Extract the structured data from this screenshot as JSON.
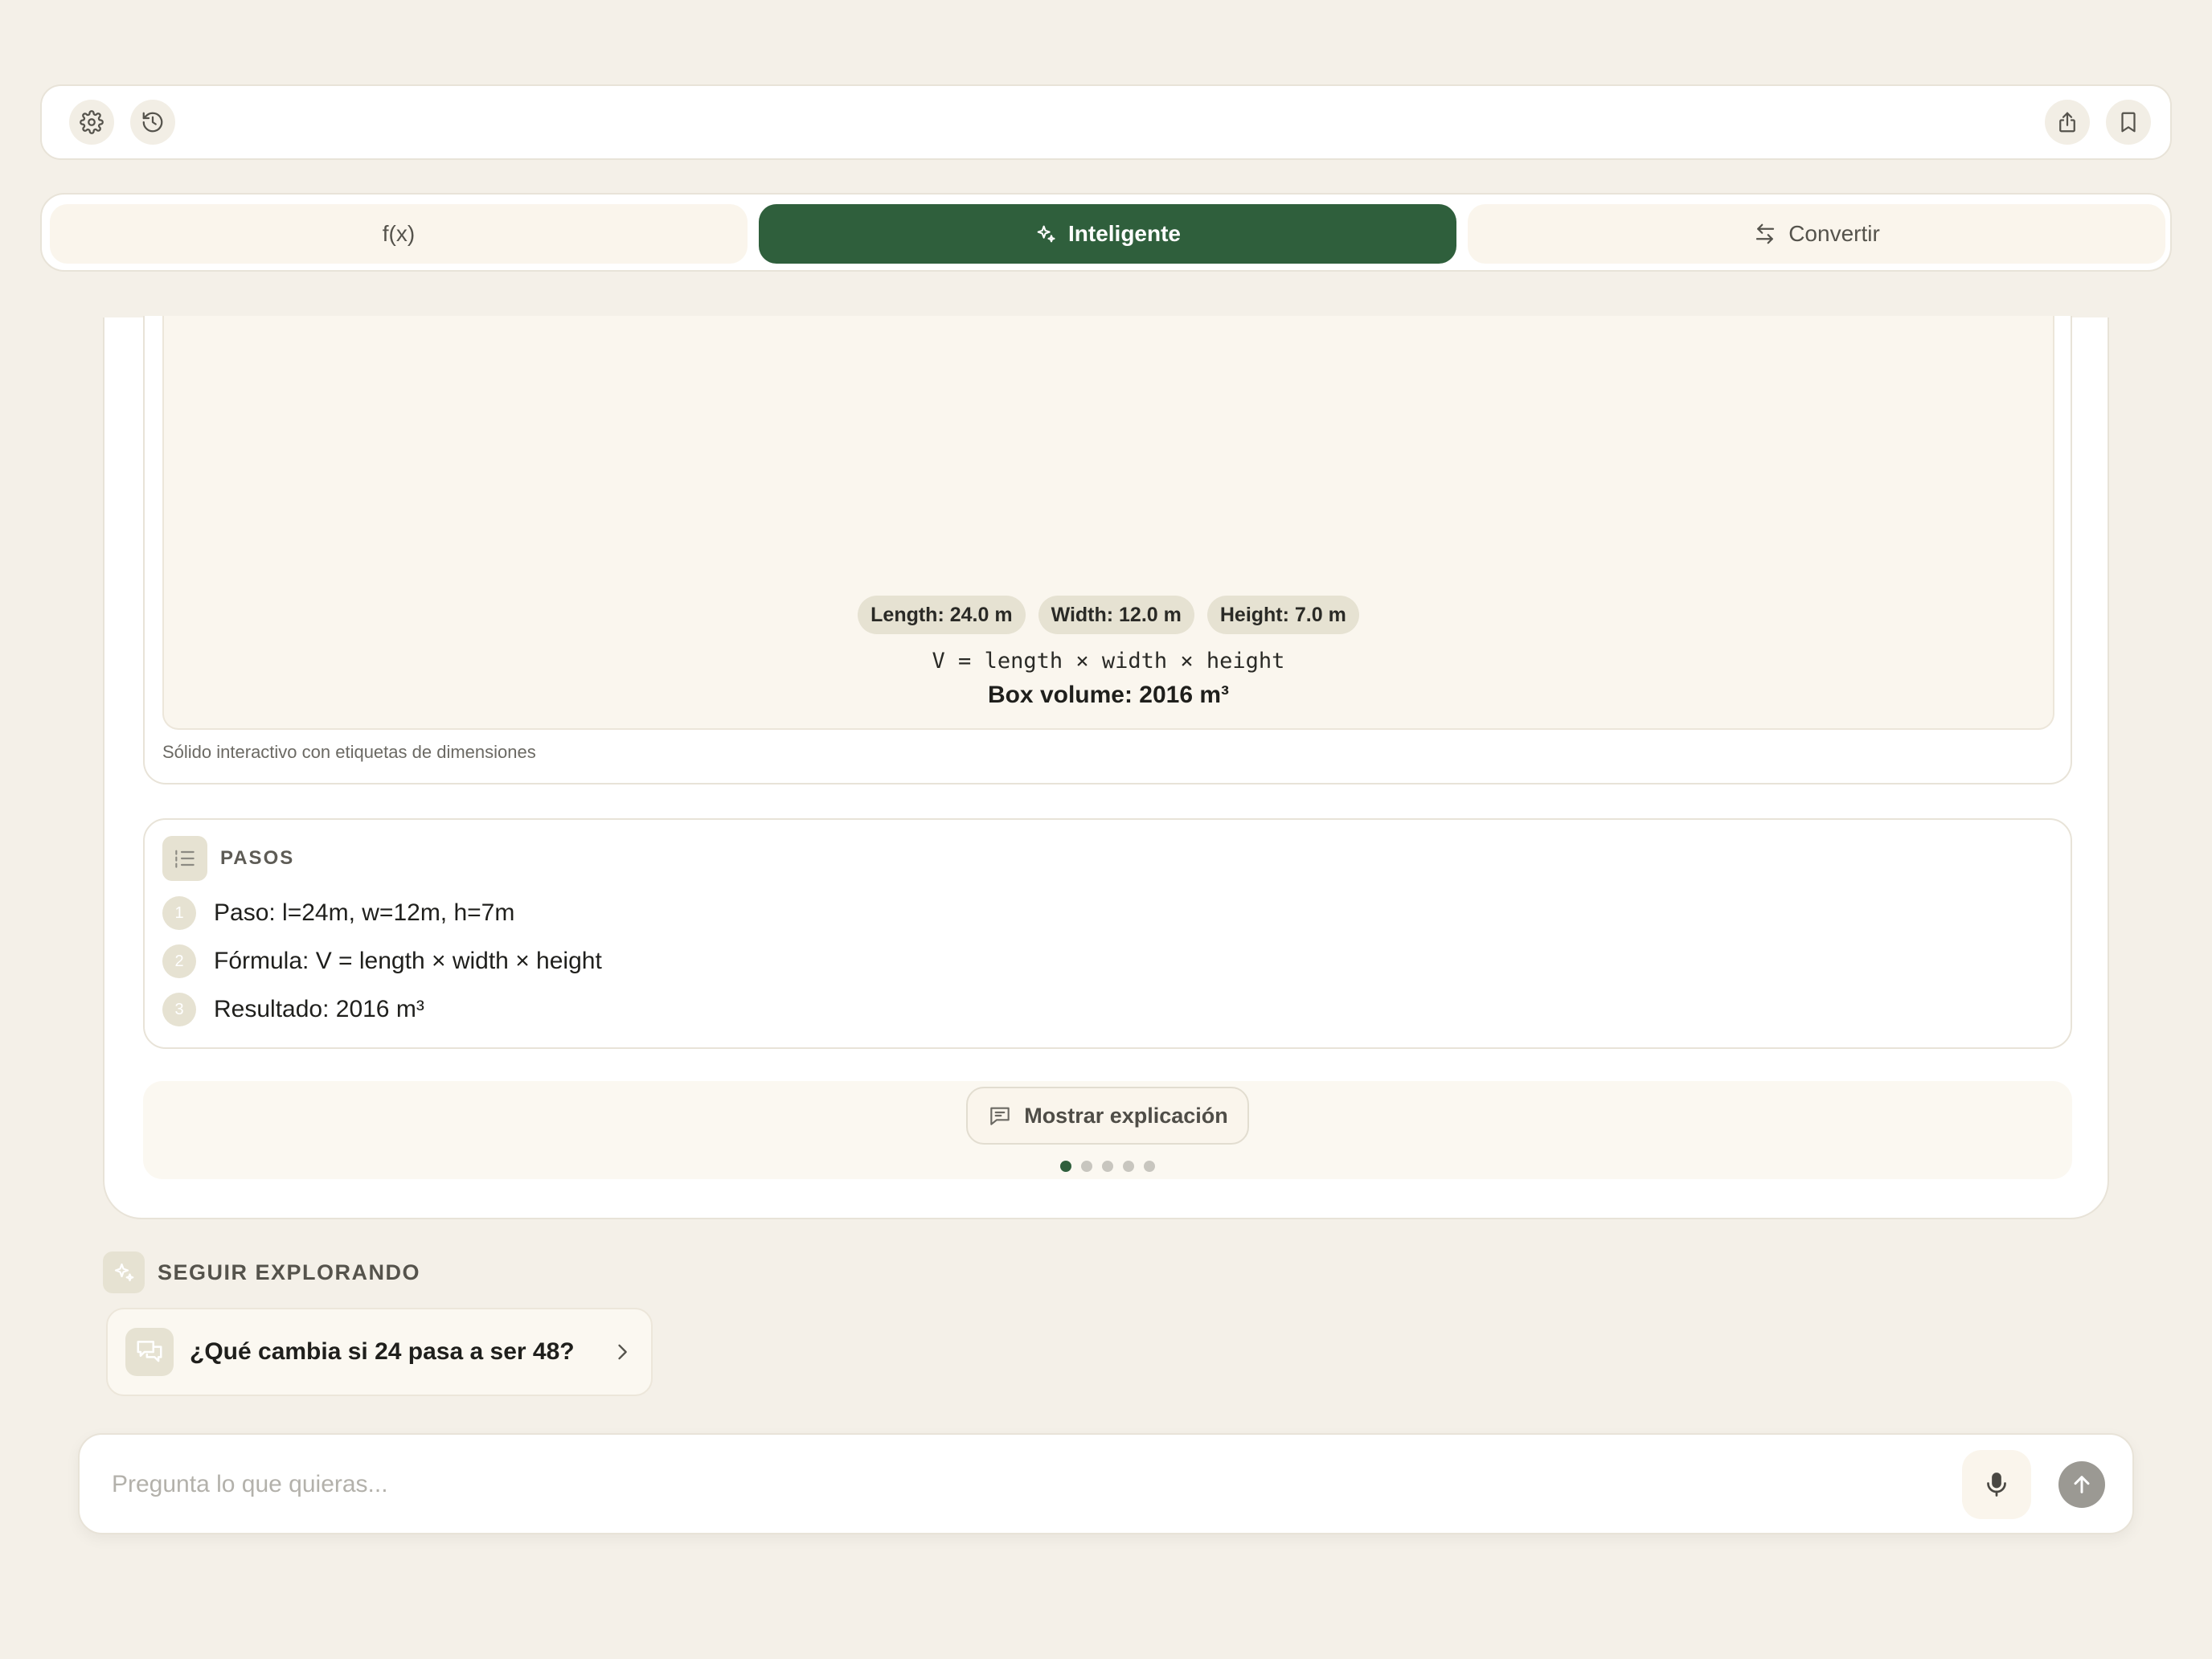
{
  "toolbar": {
    "left_icons": [
      "gear-icon",
      "history-icon"
    ],
    "right_icons": [
      "share-icon",
      "bookmark-icon"
    ]
  },
  "tabs": [
    {
      "label": "f(x)",
      "active": false
    },
    {
      "label": "Inteligente",
      "icon": "sparkle-icon",
      "active": true
    },
    {
      "label": "Convertir",
      "icon": "swap-arrows-icon",
      "active": false
    }
  ],
  "visualization": {
    "chips": [
      "Length: 24.0 m",
      "Width: 12.0 m",
      "Height: 7.0 m"
    ],
    "formula": "V = length × width × height",
    "result": "Box volume: 2016 m³",
    "caption": "Sólido interactivo con etiquetas de dimensiones"
  },
  "steps": {
    "title": "PASOS",
    "items": [
      {
        "num": "1",
        "text": "Paso: l=24m, w=12m, h=7m"
      },
      {
        "num": "2",
        "text": "Fórmula: V = length × width × height"
      },
      {
        "num": "3",
        "text": "Resultado: 2016 m³"
      }
    ]
  },
  "explain": {
    "button_label": "Mostrar explicación",
    "pages_total": 5,
    "page_active": 1
  },
  "explore": {
    "title": "SEGUIR EXPLORANDO",
    "suggestion": "¿Qué cambia si 24 pasa a ser 48?"
  },
  "input": {
    "placeholder": "Pregunta lo que quieras...",
    "value": ""
  },
  "colors": {
    "background": "#f4f0e8",
    "accent": "#2f5f3c",
    "chip": "#e6e2d2",
    "send_button": "#9b9993"
  }
}
